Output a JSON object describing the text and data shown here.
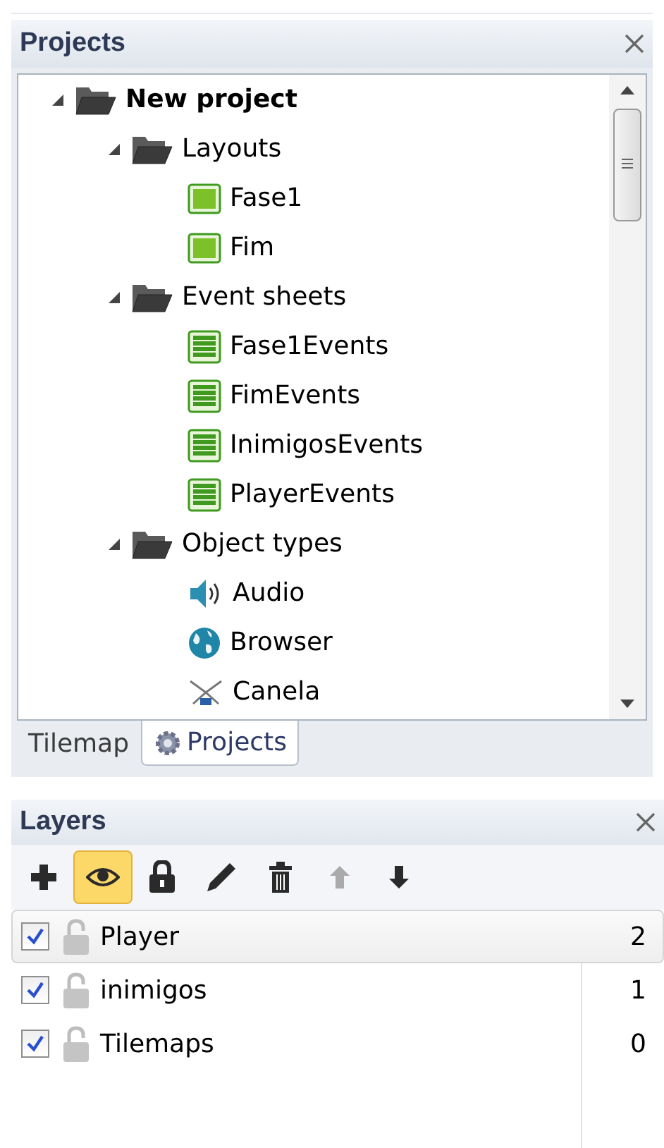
{
  "projects_panel": {
    "title": "Projects",
    "tree": [
      {
        "label": "New project",
        "kind": "folder",
        "expanded": true,
        "children": [
          {
            "label": "Layouts",
            "kind": "folder",
            "expanded": true,
            "children": [
              {
                "label": "Fase1",
                "kind": "layout"
              },
              {
                "label": "Fim",
                "kind": "layout"
              }
            ]
          },
          {
            "label": "Event sheets",
            "kind": "folder",
            "expanded": true,
            "children": [
              {
                "label": "Fase1Events",
                "kind": "eventsheet"
              },
              {
                "label": "FimEvents",
                "kind": "eventsheet"
              },
              {
                "label": "InimigosEvents",
                "kind": "eventsheet"
              },
              {
                "label": "PlayerEvents",
                "kind": "eventsheet"
              }
            ]
          },
          {
            "label": "Object types",
            "kind": "folder",
            "expanded": true,
            "children": [
              {
                "label": "Audio",
                "kind": "audio"
              },
              {
                "label": "Browser",
                "kind": "browser"
              },
              {
                "label": "Canela",
                "kind": "sprite"
              }
            ]
          }
        ]
      }
    ],
    "tabs": [
      {
        "label": "Tilemap",
        "selected": false
      },
      {
        "label": "Projects",
        "selected": true
      }
    ]
  },
  "layers_panel": {
    "title": "Layers",
    "toolbar": [
      {
        "kind": "add",
        "active": false,
        "disabled": false
      },
      {
        "kind": "eye",
        "active": true,
        "disabled": false
      },
      {
        "kind": "lock",
        "active": false,
        "disabled": false
      },
      {
        "kind": "edit",
        "active": false,
        "disabled": false
      },
      {
        "kind": "delete",
        "active": false,
        "disabled": false
      },
      {
        "kind": "up",
        "active": false,
        "disabled": true
      },
      {
        "kind": "down",
        "active": false,
        "disabled": false
      }
    ],
    "layers": [
      {
        "name": "Player",
        "visible": true,
        "locked": false,
        "number": "2",
        "selected": true
      },
      {
        "name": "inimigos",
        "visible": true,
        "locked": false,
        "number": "1",
        "selected": false
      },
      {
        "name": "Tilemaps",
        "visible": true,
        "locked": false,
        "number": "0",
        "selected": false
      }
    ]
  }
}
